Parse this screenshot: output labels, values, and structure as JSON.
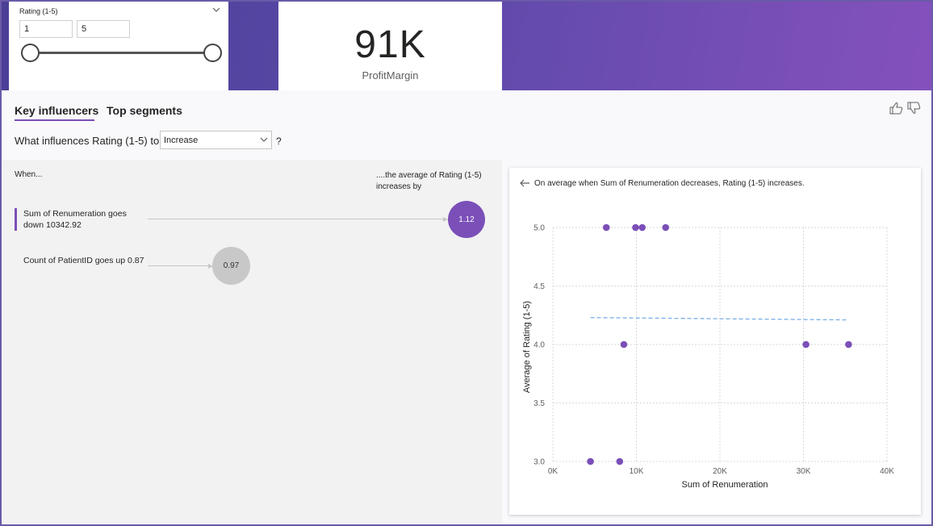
{
  "slicer": {
    "title": "Rating (1-5)",
    "min_value": "1",
    "max_value": "5"
  },
  "kpi": {
    "value": "91K",
    "label": "ProfitMargin"
  },
  "tabs": [
    {
      "label": "Key influencers",
      "active": true
    },
    {
      "label": "Top segments",
      "active": false
    }
  ],
  "question": {
    "prefix": "What influences Rating (1-5) to",
    "selected": "Increase",
    "suffix": "?"
  },
  "columns": {
    "when": "When...",
    "avg": "....the average of Rating (1-5) increases by"
  },
  "influencers": [
    {
      "label": "Sum of Renumeration goes down 10342.92",
      "value": "1.12",
      "selected": true
    },
    {
      "label": "Count of PatientID goes up 0.87",
      "value": "0.97",
      "selected": false
    }
  ],
  "scatter": {
    "title": "On average when Sum of Renumeration decreases, Rating (1-5) increases."
  },
  "colors": {
    "accent": "#7b4fb8",
    "trend": "#7aaee8",
    "neutral_bubble": "#c8c8c8"
  },
  "chart_data": {
    "type": "scatter",
    "xlabel": "Sum of Renumeration",
    "ylabel": "Average of Rating (1-5)",
    "xlim": [
      0,
      40000
    ],
    "ylim": [
      3.0,
      5.0
    ],
    "x_ticks": [
      0,
      10000,
      20000,
      30000,
      40000
    ],
    "x_tick_labels": [
      "0K",
      "10K",
      "20K",
      "30K",
      "40K"
    ],
    "y_ticks": [
      3.0,
      3.5,
      4.0,
      4.5,
      5.0
    ],
    "y_tick_labels": [
      "3.0",
      "3.5",
      "4.0",
      "4.5",
      "5.0"
    ],
    "grid": true,
    "points": [
      {
        "x": 4500,
        "y": 3.0
      },
      {
        "x": 6400,
        "y": 5.0
      },
      {
        "x": 8000,
        "y": 3.0
      },
      {
        "x": 8500,
        "y": 4.0
      },
      {
        "x": 9900,
        "y": 5.0
      },
      {
        "x": 10700,
        "y": 5.0
      },
      {
        "x": 13500,
        "y": 5.0
      },
      {
        "x": 30300,
        "y": 4.0
      },
      {
        "x": 35400,
        "y": 4.0
      }
    ],
    "trend": [
      {
        "x": 4500,
        "y": 4.23
      },
      {
        "x": 35400,
        "y": 4.21
      }
    ]
  }
}
